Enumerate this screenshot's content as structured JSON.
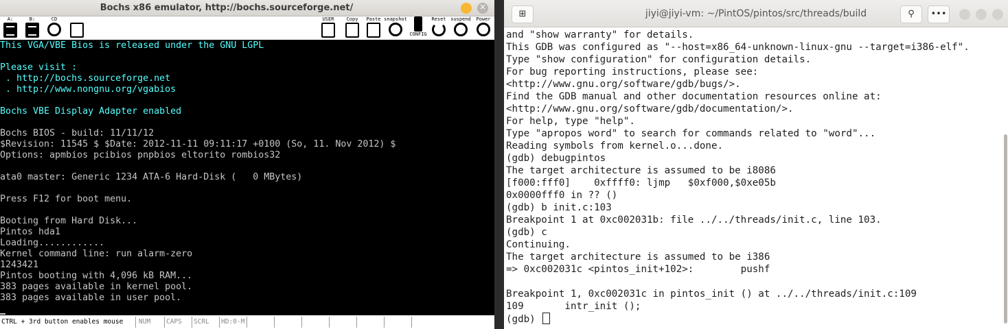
{
  "bochs": {
    "title": "Bochs x86 emulator, http://bochs.sourceforge.net/",
    "toolbar": {
      "floppy_a_label": "A:",
      "floppy_b_label": "B:",
      "cdrom_label": "CD",
      "user_label": "USER",
      "copy_label": "Copy",
      "paste_label": "Paste",
      "snapshot_label": "snapshot",
      "config_label": "CONFIG",
      "reset_label": "Reset",
      "suspend_label": "suspend",
      "power_label": "Power"
    },
    "screen_lines": [
      {
        "text": "This VGA/VBE Bios is released under the GNU LGPL",
        "cyan": true
      },
      {
        "text": "",
        "cyan": false
      },
      {
        "text": "Please visit :",
        "cyan": true
      },
      {
        "text": " . http://bochs.sourceforge.net",
        "cyan": true
      },
      {
        "text": " . http://www.nongnu.org/vgabios",
        "cyan": true
      },
      {
        "text": "",
        "cyan": false
      },
      {
        "text": "Bochs VBE Display Adapter enabled",
        "cyan": true
      },
      {
        "text": "",
        "cyan": false
      },
      {
        "text": "Bochs BIOS - build: 11/11/12",
        "cyan": false
      },
      {
        "text": "$Revision: 11545 $ $Date: 2012-11-11 09:11:17 +0100 (So, 11. Nov 2012) $",
        "cyan": false
      },
      {
        "text": "Options: apmbios pcibios pnpbios eltorito rombios32",
        "cyan": false
      },
      {
        "text": "",
        "cyan": false
      },
      {
        "text": "ata0 master: Generic 1234 ATA-6 Hard-Disk (   0 MBytes)",
        "cyan": false
      },
      {
        "text": "",
        "cyan": false
      },
      {
        "text": "Press F12 for boot menu.",
        "cyan": false
      },
      {
        "text": "",
        "cyan": false
      },
      {
        "text": "Booting from Hard Disk...",
        "cyan": false
      },
      {
        "text": "Pintos hda1",
        "cyan": false
      },
      {
        "text": "Loading............",
        "cyan": false
      },
      {
        "text": "Kernel command line: run alarm-zero",
        "cyan": false
      },
      {
        "text": "1243421",
        "cyan": false
      },
      {
        "text": "Pintos booting with 4,096 kB RAM...",
        "cyan": false
      },
      {
        "text": "383 pages available in kernel pool.",
        "cyan": false
      },
      {
        "text": "383 pages available in user pool.",
        "cyan": false
      }
    ],
    "status": {
      "mouse_hint": "CTRL + 3rd button enables mouse",
      "num": "NUM",
      "caps": "CAPS",
      "scrl": "SCRL",
      "hd": "HD:0-M"
    }
  },
  "terminal": {
    "title": "jiyi@jiyi-vm: ~/PintOS/pintos/src/threads/build",
    "lines": [
      "and \"show warranty\" for details.",
      "This GDB was configured as \"--host=x86_64-unknown-linux-gnu --target=i386-elf\".",
      "Type \"show configuration\" for configuration details.",
      "For bug reporting instructions, please see:",
      "<http://www.gnu.org/software/gdb/bugs/>.",
      "Find the GDB manual and other documentation resources online at:",
      "<http://www.gnu.org/software/gdb/documentation/>.",
      "For help, type \"help\".",
      "Type \"apropos word\" to search for commands related to \"word\"...",
      "Reading symbols from kernel.o...done.",
      "(gdb) debugpintos",
      "The target architecture is assumed to be i8086",
      "[f000:fff0]    0xffff0: ljmp   $0xf000,$0xe05b",
      "0x0000fff0 in ?? ()",
      "(gdb) b init.c:103",
      "Breakpoint 1 at 0xc002031b: file ../../threads/init.c, line 103.",
      "(gdb) c",
      "Continuing.",
      "The target architecture is assumed to be i386",
      "=> 0xc002031c <pintos_init+102>:        pushf",
      "",
      "Breakpoint 1, 0xc002031c in pintos_init () at ../../threads/init.c:109",
      "109       intr_init ();"
    ],
    "prompt": "(gdb) "
  }
}
